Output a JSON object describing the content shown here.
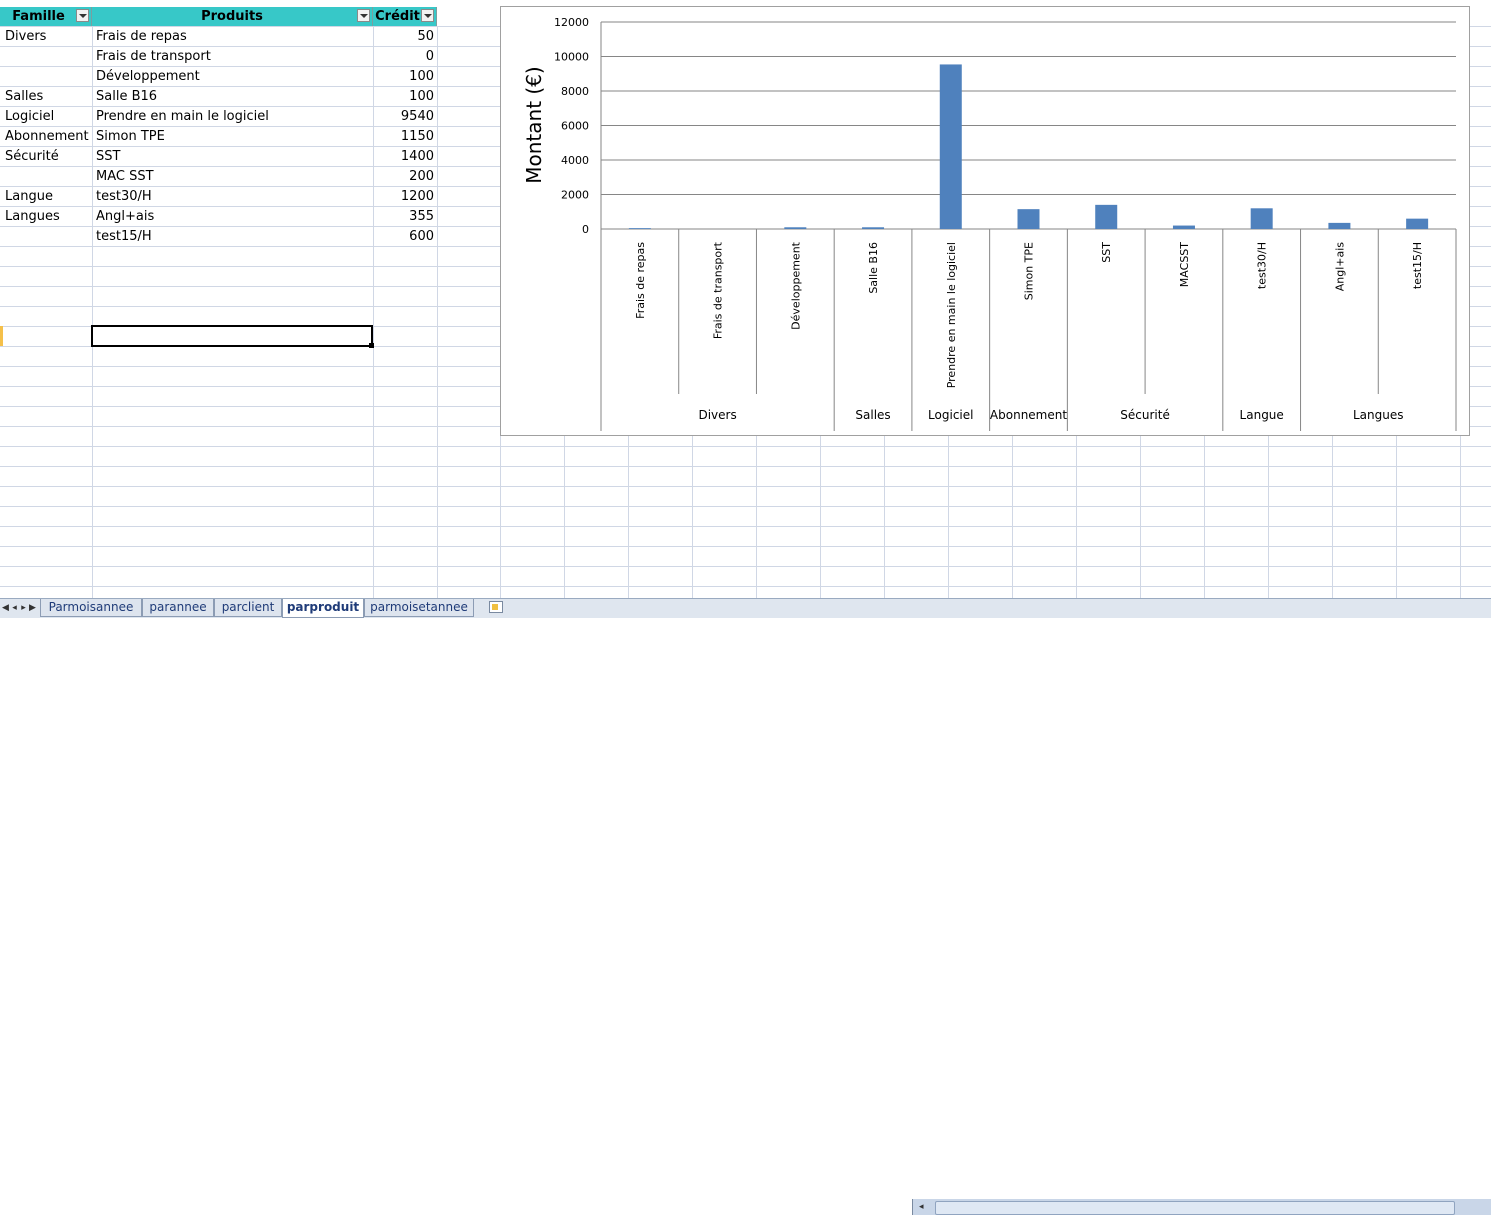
{
  "sheet": {
    "headers": {
      "famille": "Famille",
      "produits": "Produits",
      "credit": "Crédit"
    },
    "rows": [
      {
        "famille": "Divers",
        "produit": "Frais de repas",
        "credit": "50"
      },
      {
        "famille": "",
        "produit": "Frais de transport",
        "credit": "0"
      },
      {
        "famille": "",
        "produit": "Développement",
        "credit": "100"
      },
      {
        "famille": "Salles",
        "produit": "Salle B16",
        "credit": "100"
      },
      {
        "famille": "Logiciel",
        "produit": "Prendre en main le logiciel",
        "credit": "9540"
      },
      {
        "famille": "Abonnement",
        "produit": "Simon TPE",
        "credit": "1150"
      },
      {
        "famille": "Sécurité",
        "produit": "SST",
        "credit": "1400"
      },
      {
        "famille": "",
        "produit": "MAC SST",
        "credit": "200"
      },
      {
        "famille": "Langue",
        "produit": "test30/H",
        "credit": "1200"
      },
      {
        "famille": "Langues",
        "produit": "Angl+ais",
        "credit": "355"
      },
      {
        "famille": "",
        "produit": "test15/H",
        "credit": "600"
      }
    ]
  },
  "colors": {
    "header_fill": "#37c8c8",
    "bar_color": "#4f81bd",
    "gridline": "#d0d7e5"
  },
  "chart_data": {
    "type": "bar",
    "ylabel": "Montant (€)",
    "ylim": [
      0,
      12000
    ],
    "yticks": [
      "0",
      "2000",
      "4000",
      "6000",
      "8000",
      "10000",
      "12000"
    ],
    "grid": true,
    "categories": [
      "Frais de repas",
      "Frais de transport",
      "Développement",
      "Salle B16",
      "Prendre en main le logiciel",
      "Simon TPE",
      "SST",
      "MACSST",
      "test30/H",
      "Angl+ais",
      "test15/H"
    ],
    "values": [
      50,
      0,
      100,
      100,
      9540,
      1150,
      1400,
      200,
      1200,
      355,
      600
    ],
    "groups": [
      {
        "label": "Divers",
        "count": 3
      },
      {
        "label": "Salles",
        "count": 1
      },
      {
        "label": "Logiciel",
        "count": 1
      },
      {
        "label": "Abonnement",
        "count": 1
      },
      {
        "label": "Sécurité",
        "count": 2
      },
      {
        "label": "Langue",
        "count": 1
      },
      {
        "label": "Langues",
        "count": 2
      }
    ]
  },
  "tabs": [
    {
      "label": "Parmoisannee",
      "active": false
    },
    {
      "label": "parannee",
      "active": false
    },
    {
      "label": "parclient",
      "active": false
    },
    {
      "label": "parproduit",
      "active": true
    },
    {
      "label": "parmoisetannee",
      "active": false
    }
  ],
  "icons": {
    "new_sheet": "insert-sheet-icon",
    "nav_first": "nav-first-icon",
    "nav_prev": "nav-prev-icon",
    "nav_next": "nav-next-icon",
    "nav_last": "nav-last-icon"
  }
}
